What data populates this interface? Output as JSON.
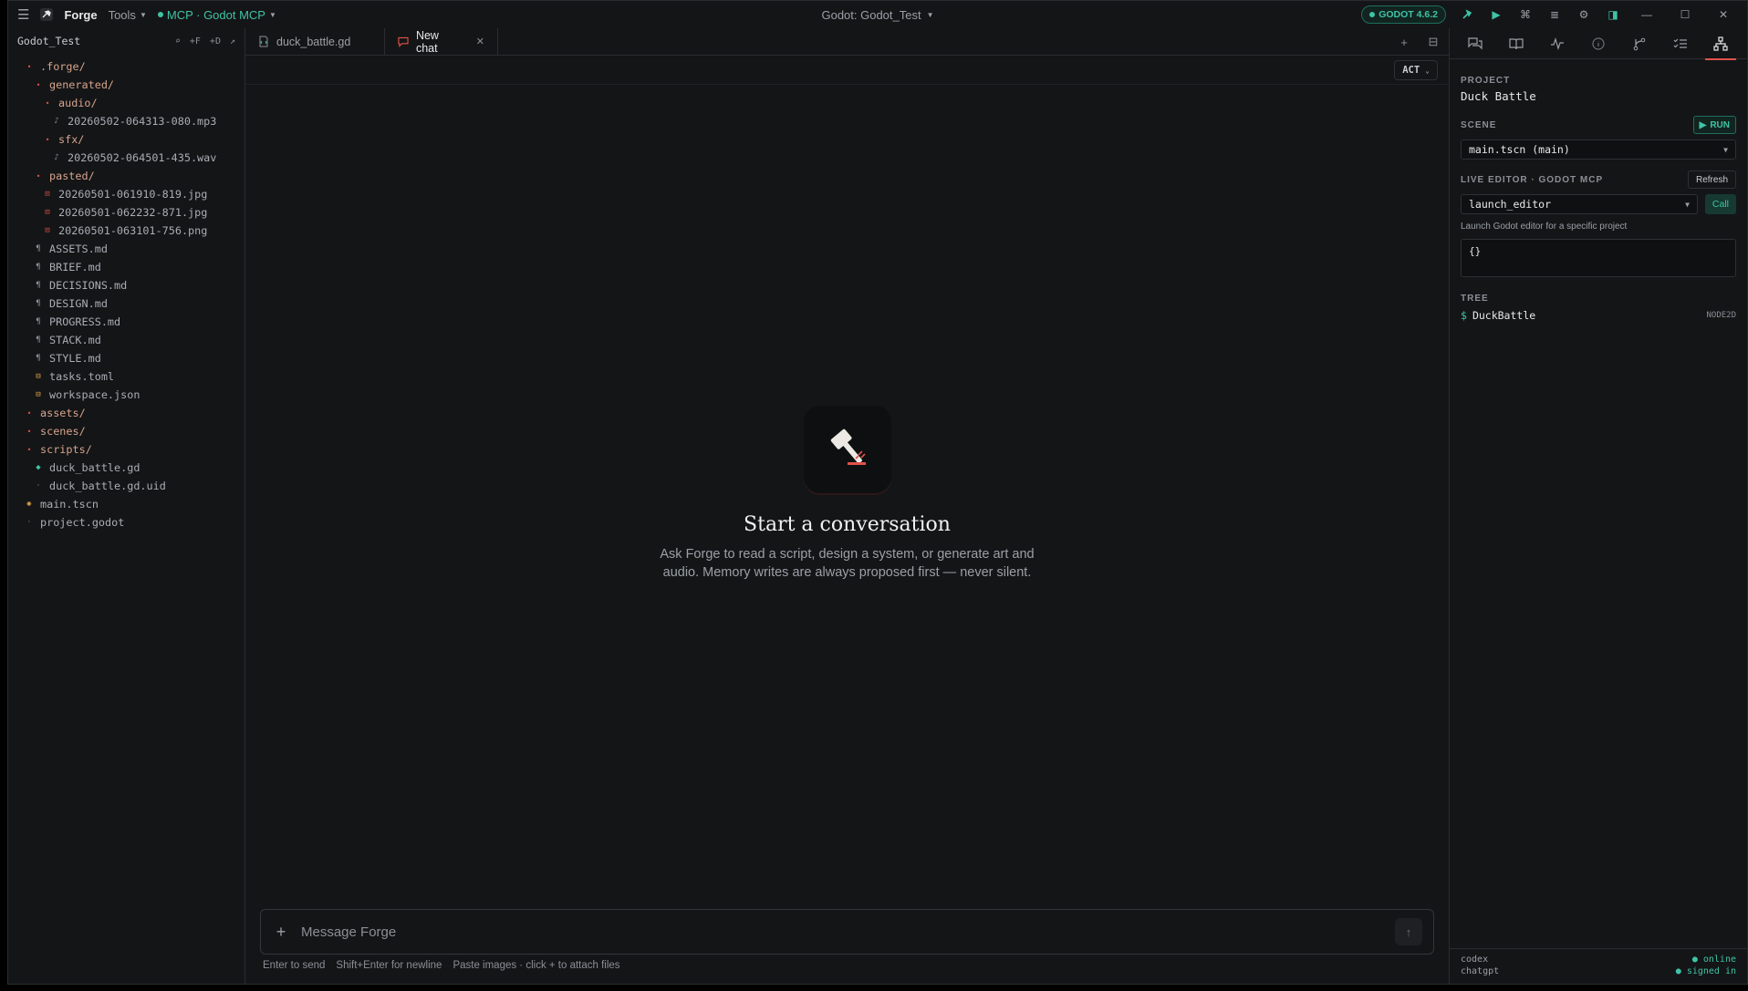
{
  "titlebar": {
    "app_name": "Forge",
    "tools_label": "Tools",
    "mcp_label": "MCP · Godot MCP",
    "window_title": "Godot: Godot_Test",
    "godot_badge": "GODOT 4.6.2"
  },
  "sidebar": {
    "project": "Godot_Test",
    "actions": [
      "⌕",
      "+F",
      "+D",
      "↗"
    ],
    "tree": [
      {
        "label": ".forge/",
        "depth": 0,
        "kind": "folder"
      },
      {
        "label": "generated/",
        "depth": 1,
        "kind": "folder"
      },
      {
        "label": "audio/",
        "depth": 2,
        "kind": "folder"
      },
      {
        "label": "20260502-064313-080.mp3",
        "depth": 3,
        "kind": "audio"
      },
      {
        "label": "sfx/",
        "depth": 2,
        "kind": "folder"
      },
      {
        "label": "20260502-064501-435.wav",
        "depth": 3,
        "kind": "audio"
      },
      {
        "label": "pasted/",
        "depth": 1,
        "kind": "folder"
      },
      {
        "label": "20260501-061910-819.jpg",
        "depth": 2,
        "kind": "img"
      },
      {
        "label": "20260501-062232-871.jpg",
        "depth": 2,
        "kind": "img"
      },
      {
        "label": "20260501-063101-756.png",
        "depth": 2,
        "kind": "img"
      },
      {
        "label": "ASSETS.md",
        "depth": 1,
        "kind": "md"
      },
      {
        "label": "BRIEF.md",
        "depth": 1,
        "kind": "md"
      },
      {
        "label": "DECISIONS.md",
        "depth": 1,
        "kind": "md"
      },
      {
        "label": "DESIGN.md",
        "depth": 1,
        "kind": "md"
      },
      {
        "label": "PROGRESS.md",
        "depth": 1,
        "kind": "md"
      },
      {
        "label": "STACK.md",
        "depth": 1,
        "kind": "md"
      },
      {
        "label": "STYLE.md",
        "depth": 1,
        "kind": "md"
      },
      {
        "label": "tasks.toml",
        "depth": 1,
        "kind": "toml"
      },
      {
        "label": "workspace.json",
        "depth": 1,
        "kind": "toml"
      },
      {
        "label": "assets/",
        "depth": 0,
        "kind": "folder"
      },
      {
        "label": "scenes/",
        "depth": 0,
        "kind": "folder"
      },
      {
        "label": "scripts/",
        "depth": 0,
        "kind": "folder"
      },
      {
        "label": "duck_battle.gd",
        "depth": 1,
        "kind": "gd"
      },
      {
        "label": "duck_battle.gd.uid",
        "depth": 1,
        "kind": "uid"
      },
      {
        "label": "main.tscn",
        "depth": 0,
        "kind": "tscn"
      },
      {
        "label": "project.godot",
        "depth": 0,
        "kind": "uid"
      }
    ]
  },
  "tabs": [
    {
      "label": "duck_battle.gd"
    },
    {
      "label": "New chat"
    }
  ],
  "mode": {
    "label": "ACT"
  },
  "empty_state": {
    "title": "Start a conversation",
    "subtitle": "Ask Forge to read a script, design a system, or generate art and audio. Memory writes are always proposed first — never silent."
  },
  "composer": {
    "placeholder": "Message Forge",
    "hints": [
      "Enter to send",
      "Shift+Enter for newline",
      "Paste images · click + to attach files"
    ]
  },
  "right_panel": {
    "project_label": "PROJECT",
    "project_name": "Duck Battle",
    "scene_label": "SCENE",
    "run_label": "RUN",
    "scene_value": "main.tscn (main)",
    "live_editor_label": "LIVE EDITOR · GODOT MCP",
    "refresh_label": "Refresh",
    "tool_value": "launch_editor",
    "call_label": "Call",
    "tool_desc": "Launch Godot editor for a specific project",
    "args_value": "{}",
    "tree_label": "TREE",
    "tree_node": "DuckBattle",
    "tree_node_type": "NODE2D",
    "footer": [
      {
        "key": "codex",
        "status": "online"
      },
      {
        "key": "chatgpt",
        "status": "signed in"
      }
    ]
  }
}
